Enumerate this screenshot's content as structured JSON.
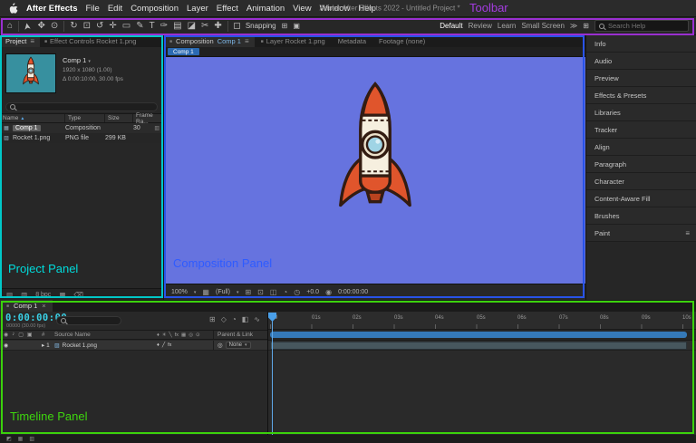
{
  "menubar": {
    "app_name": "After Effects",
    "items": [
      "File",
      "Edit",
      "Composition",
      "Layer",
      "Effect",
      "Animation",
      "View",
      "Window",
      "Help"
    ],
    "window_title": "Adobe After Effects 2022 - Untitled Project *"
  },
  "annotations": {
    "toolbar": {
      "label": "Toolbar",
      "color": "#a43ce0"
    },
    "project": {
      "label": "Project Panel",
      "color": "#00dbdb"
    },
    "composition": {
      "label": "Composition Panel",
      "color": "#2e5bff"
    },
    "timeline": {
      "label": "Timeline Panel",
      "color": "#3ed60e"
    }
  },
  "toolbar": {
    "snapping_label": "Snapping",
    "workspaces": [
      "Default",
      "Review",
      "Learn",
      "Small Screen"
    ],
    "overflow": "≫",
    "search_placeholder": "Search Help",
    "tools": [
      {
        "name": "home",
        "glyph": "⌂"
      },
      {
        "name": "selection",
        "glyph": "➤"
      },
      {
        "name": "hand",
        "glyph": "✥"
      },
      {
        "name": "zoom",
        "glyph": "⊙"
      },
      {
        "name": "orbit",
        "glyph": "↻"
      },
      {
        "name": "camera",
        "glyph": "⊡"
      },
      {
        "name": "rotate",
        "glyph": "↺"
      },
      {
        "name": "pan-behind",
        "glyph": "✛"
      },
      {
        "name": "shape",
        "glyph": "▭"
      },
      {
        "name": "pen",
        "glyph": "✎"
      },
      {
        "name": "type",
        "glyph": "T"
      },
      {
        "name": "brush",
        "glyph": "✑"
      },
      {
        "name": "clone-stamp",
        "glyph": "▤"
      },
      {
        "name": "eraser",
        "glyph": "◪"
      },
      {
        "name": "roto-brush",
        "glyph": "✂"
      },
      {
        "name": "puppet",
        "glyph": "✚"
      }
    ]
  },
  "project_panel": {
    "tab_active": "Project",
    "tab_inactive": "Effect Controls Rocket 1.png",
    "preview": {
      "name": "Comp 1",
      "dimensions": "1920 x 1080 (1.00)",
      "duration": "Δ 0:00:10:00, 30.00 fps"
    },
    "columns": [
      "Name",
      "Type",
      "Size",
      "Frame Ra..."
    ],
    "rows": [
      {
        "name": "Comp 1",
        "type": "Composition",
        "size": "",
        "frame_rate": "30"
      },
      {
        "name": "Rocket 1.png",
        "type": "PNG file",
        "size": "299 KB",
        "frame_rate": ""
      }
    ],
    "footer_bpc": "8 bpc"
  },
  "composition_panel": {
    "tab_active_prefix": "Composition",
    "tab_active_name": "Comp 1",
    "tab_layer": "Layer Rocket 1.png",
    "tab_metadata": "Metadata",
    "tab_footage": "Footage (none)",
    "viewer_chip": "Comp 1",
    "footer": {
      "zoom": "100%",
      "resolution": "(Full)",
      "exposure": "+0.0",
      "timecode": "0:00:00:00"
    }
  },
  "right_panels": {
    "items": [
      "Info",
      "Audio",
      "Preview",
      "Effects & Presets",
      "Libraries",
      "Tracker",
      "Align",
      "Paragraph",
      "Character",
      "Content-Aware Fill",
      "Brushes",
      "Paint"
    ]
  },
  "timeline_panel": {
    "tab": "Comp 1",
    "timecode": "0:00:00:00",
    "frame_info": "00000 (30.00 fps)",
    "ruler_ticks": [
      ":00",
      "01s",
      "02s",
      "03s",
      "04s",
      "05s",
      "06s",
      "07s",
      "08s",
      "09s",
      "10s"
    ],
    "columns": {
      "index": "#",
      "source_name": "Source Name",
      "parent_link": "Parent & Link"
    },
    "layers": [
      {
        "index": "1",
        "name": "Rocket 1.png",
        "parent_value": "None"
      }
    ]
  },
  "icons": {
    "square": "■",
    "burger": "≡",
    "chev_down": "▾",
    "sort_up": "▲",
    "comp_item": "▦",
    "footage_item": "▨",
    "used_badge": "▥",
    "interpret": "▤",
    "folder": "▥",
    "newcomp": "▦",
    "trash": "⌫",
    "snap_a": "⊞",
    "snap_b": "▣",
    "workspace_grid": "⊞",
    "cf_grid": "⊞",
    "cf_mask": "⊡",
    "cf_region": "◫",
    "cf_channels": "◔",
    "cf_res": "▦",
    "exposure_clock": "◷",
    "camera_snap": "◉",
    "mini_flowchart": "⊞",
    "draft3d": "◇",
    "shy": "◔",
    "frame_blend": "◧",
    "graph": "∿",
    "eye": "◉",
    "audio": "♪",
    "solo": "▢",
    "lock": "▣",
    "sw_shy": "♦",
    "sw_collapse": "✳",
    "sw_quality": "╲",
    "sw_fx": "fx",
    "sw_blend": "▦",
    "sw_motion": "◎",
    "sw_3d": "⊙",
    "sw_slash": "╱",
    "twirl": "▸",
    "pickwhip": "◎",
    "close": "×",
    "toggle_a": "◩",
    "toggle_b": "▦",
    "toggle_c": "▥"
  }
}
